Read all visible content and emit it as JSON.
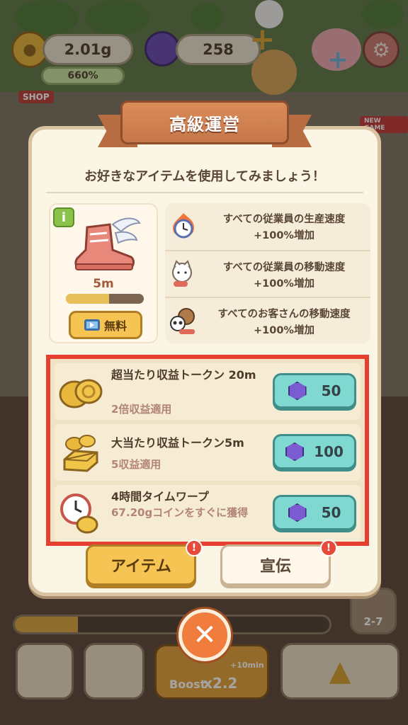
{
  "hud": {
    "coins": "2.01g",
    "boost_rate": "660%",
    "gems": "258",
    "shop_label": "SHOP",
    "new_game_label": "NEW GAME"
  },
  "modal": {
    "title": "高級運営",
    "subtitle": "お好きなアイテムを使用してみましょう！",
    "item": {
      "info_label": "i",
      "time": "5m",
      "progress": 0.55,
      "free_label": "無料"
    },
    "effects": [
      {
        "icon": "fire-clock-icon",
        "line1": "すべての従業員の生産速度",
        "line2": "+100%増加"
      },
      {
        "icon": "running-cat-icon",
        "line1": "すべての従業員の移動速度",
        "line2": "+100%増加"
      },
      {
        "icon": "running-customers-icon",
        "line1": "すべてのお客さんの移動速度",
        "line2": "+100%増加"
      }
    ],
    "shop": [
      {
        "icon": "gold-coins-icon",
        "name": "超当たり収益トークン 20m",
        "desc": "2倍収益適用",
        "price": "50"
      },
      {
        "icon": "gold-bars-icon",
        "name": "大当たり収益トークン5m",
        "desc": "5収益適用",
        "price": "100"
      },
      {
        "icon": "clock-coins-icon",
        "name": "4時間タイムワープ",
        "desc": "67.20gコインをすぐに獲得",
        "price": "50"
      }
    ],
    "tabs": {
      "items": "アイテム",
      "ads": "宣伝",
      "alert": "!"
    }
  },
  "bottom": {
    "boost_label": "Boost",
    "boost_multiplier": "x2.2",
    "boost_bonus": "+10min",
    "stage": "2-7",
    "progress": 0.2
  },
  "close_label": "✕"
}
